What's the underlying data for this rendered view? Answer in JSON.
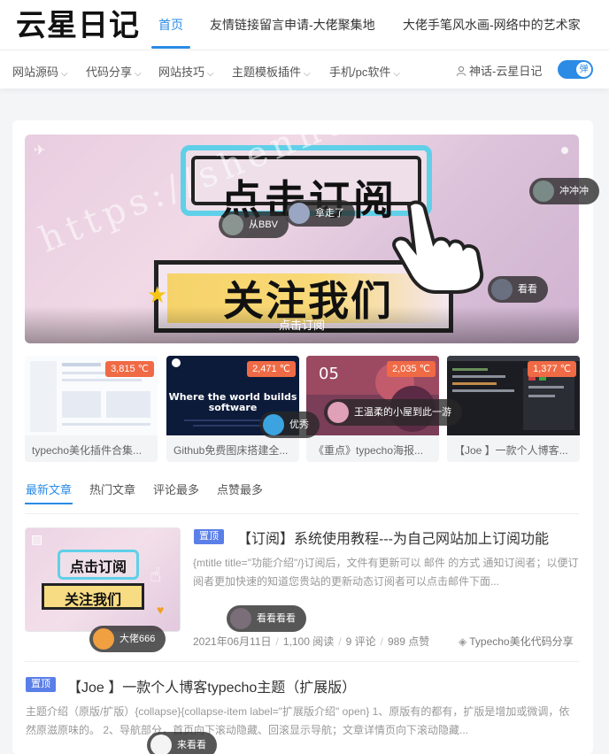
{
  "header": {
    "logo_text": "云星日记",
    "nav": [
      {
        "label": "首页",
        "active": true
      },
      {
        "label": "友情链接留言申请-大佬聚集地",
        "active": false
      },
      {
        "label": "大佬手笔风水画-网络中的艺术家",
        "active": false
      }
    ]
  },
  "subnav": {
    "items": [
      "网站源码",
      "代码分享",
      "网站技巧",
      "主题模板插件",
      "手机/pc软件"
    ],
    "user_label": "神话-云星日记",
    "toggle_label": "弹",
    "toggle_on": true
  },
  "banner": {
    "caption": "点击订阅",
    "headline1": "点击订阅",
    "headline2": "关注我们",
    "watermark": "https://shenhuaw1.com"
  },
  "danmaku": [
    {
      "text": "冲冲冲"
    },
    {
      "text": "从BBV"
    },
    {
      "text": "拿走了"
    },
    {
      "text": "看看"
    },
    {
      "text": "优秀"
    },
    {
      "text": "王温柔的小屋到此一游"
    },
    {
      "text": "看看看看"
    },
    {
      "text": "大佬666"
    },
    {
      "text": "来看看"
    }
  ],
  "featured": [
    {
      "title": "typecho美化插件合集...",
      "temp": "3,815 ℃"
    },
    {
      "title": "Github免费图床搭建全...",
      "temp": "2,471 ℃",
      "image_text": "Where the world builds software"
    },
    {
      "title": "《重点》typecho海报...",
      "temp": "2,035 ℃",
      "image_text": "05"
    },
    {
      "title": "【Joe 】一款个人博客...",
      "temp": "1,377 ℃"
    }
  ],
  "tabs": [
    {
      "label": "最新文章",
      "active": true
    },
    {
      "label": "热门文章",
      "active": false
    },
    {
      "label": "评论最多",
      "active": false
    },
    {
      "label": "点赞最多",
      "active": false
    }
  ],
  "articles": [
    {
      "pin": "置顶",
      "title": "【订阅】系统使用教程---为自己网站加上订阅功能",
      "excerpt": "{mtitle title=\"功能介绍\"/}订阅后，文件有更新可以 邮件 的方式 通知订阅者；以便订阅者更加快速的知道您贵站的更新动态订阅者可以点击邮件下面...",
      "thumb_text1": "点击订阅",
      "thumb_text2": "关注我们",
      "date": "2021年06月11日",
      "reads": "1,100 阅读",
      "comments": "9 评论",
      "likes": "989 点赞",
      "category": "Typecho美化代码分享"
    },
    {
      "pin": "置顶",
      "title": "【Joe 】一款个人博客typecho主题（扩展版）",
      "excerpt": "主题介绍（原版/扩版）{collapse}{collapse-item label=\"扩展版介绍\" open} 1、原版有的都有，扩版是增加或微调，依然原滋原味的。 2、导航部分，首页向下滚动隐藏、回滚显示导航；文章详情页向下滚动隐藏..."
    }
  ],
  "colors": {
    "accent": "#2b8be5",
    "pin": "#5b7fe8",
    "temp_badge": "#f06a45"
  }
}
